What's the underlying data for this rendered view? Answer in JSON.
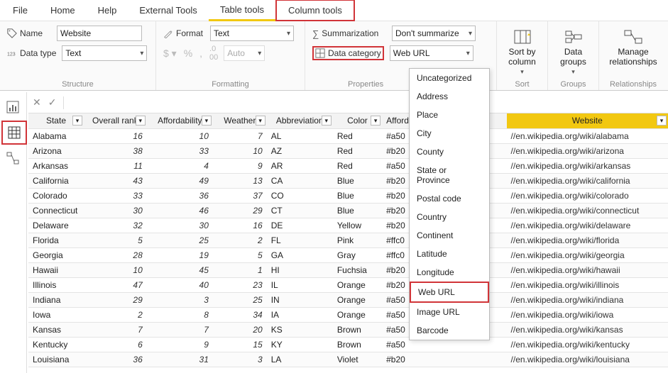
{
  "menu": {
    "items": [
      "File",
      "Home",
      "Help",
      "External Tools",
      "Table tools",
      "Column tools"
    ],
    "active_index": 4,
    "highlight_index": 5
  },
  "ribbon": {
    "structure": {
      "label": "Structure",
      "name_label": "Name",
      "name_value": "Website",
      "datatype_label": "Data type",
      "datatype_value": "Text"
    },
    "formatting": {
      "label": "Formatting",
      "format_label": "Format",
      "format_value": "Text",
      "auto_label": "Auto"
    },
    "properties": {
      "label": "Properties",
      "summarization_label": "Summarization",
      "summarization_value": "Don't summarize",
      "datacategory_label": "Data category",
      "datacategory_value": "Web URL"
    },
    "sort": {
      "label": "Sort",
      "btn": "Sort by\ncolumn"
    },
    "groups": {
      "label": "Groups",
      "btn": "Data\ngroups"
    },
    "relationships": {
      "label": "Relationships",
      "btn": "Manage\nrelationships"
    }
  },
  "data_category_options": [
    "Uncategorized",
    "Address",
    "Place",
    "City",
    "County",
    "State or Province",
    "Postal code",
    "Country",
    "Continent",
    "Latitude",
    "Longitude",
    "Web URL",
    "Image URL",
    "Barcode"
  ],
  "data_category_highlight": "Web URL",
  "table": {
    "columns": [
      "State",
      "Overall rank",
      "Affordability",
      "Weather",
      "Abbreviation",
      "Color",
      "Affordability color",
      "",
      "Website"
    ],
    "highlight_col": "Website",
    "rows": [
      {
        "state": "Alabama",
        "rank": 16,
        "aff": 10,
        "wea": 7,
        "abb": "AL",
        "color": "Red",
        "affc": "#a50",
        "url": "//en.wikipedia.org/wiki/alabama"
      },
      {
        "state": "Arizona",
        "rank": 38,
        "aff": 33,
        "wea": 10,
        "abb": "AZ",
        "color": "Red",
        "affc": "#b20",
        "url": "//en.wikipedia.org/wiki/arizona"
      },
      {
        "state": "Arkansas",
        "rank": 11,
        "aff": 4,
        "wea": 9,
        "abb": "AR",
        "color": "Red",
        "affc": "#a50",
        "url": "//en.wikipedia.org/wiki/arkansas"
      },
      {
        "state": "California",
        "rank": 43,
        "aff": 49,
        "wea": 13,
        "abb": "CA",
        "color": "Blue",
        "affc": "#b20",
        "url": "//en.wikipedia.org/wiki/california"
      },
      {
        "state": "Colorado",
        "rank": 33,
        "aff": 36,
        "wea": 37,
        "abb": "CO",
        "color": "Blue",
        "affc": "#b20",
        "url": "//en.wikipedia.org/wiki/colorado"
      },
      {
        "state": "Connecticut",
        "rank": 30,
        "aff": 46,
        "wea": 29,
        "abb": "CT",
        "color": "Blue",
        "affc": "#b20",
        "url": "//en.wikipedia.org/wiki/connecticut"
      },
      {
        "state": "Delaware",
        "rank": 32,
        "aff": 30,
        "wea": 16,
        "abb": "DE",
        "color": "Yellow",
        "affc": "#b20",
        "url": "//en.wikipedia.org/wiki/delaware"
      },
      {
        "state": "Florida",
        "rank": 5,
        "aff": 25,
        "wea": 2,
        "abb": "FL",
        "color": "Pink",
        "affc": "#ffc0",
        "url": "//en.wikipedia.org/wiki/florida"
      },
      {
        "state": "Georgia",
        "rank": 28,
        "aff": 19,
        "wea": 5,
        "abb": "GA",
        "color": "Gray",
        "affc": "#ffc0",
        "url": "//en.wikipedia.org/wiki/georgia"
      },
      {
        "state": "Hawaii",
        "rank": 10,
        "aff": 45,
        "wea": 1,
        "abb": "HI",
        "color": "Fuchsia",
        "affc": "#b20",
        "url": "//en.wikipedia.org/wiki/hawaii"
      },
      {
        "state": "Illinois",
        "rank": 47,
        "aff": 40,
        "wea": 23,
        "abb": "IL",
        "color": "Orange",
        "affc": "#b20",
        "url": "//en.wikipedia.org/wiki/illinois"
      },
      {
        "state": "Indiana",
        "rank": 29,
        "aff": 3,
        "wea": 25,
        "abb": "IN",
        "color": "Orange",
        "affc": "#a50",
        "url": "//en.wikipedia.org/wiki/indiana"
      },
      {
        "state": "Iowa",
        "rank": 2,
        "aff": 8,
        "wea": 34,
        "abb": "IA",
        "color": "Orange",
        "affc": "#a50",
        "url": "//en.wikipedia.org/wiki/iowa"
      },
      {
        "state": "Kansas",
        "rank": 7,
        "aff": 7,
        "wea": 20,
        "abb": "KS",
        "color": "Brown",
        "affc": "#a50",
        "url": "//en.wikipedia.org/wiki/kansas"
      },
      {
        "state": "Kentucky",
        "rank": 6,
        "aff": 9,
        "wea": 15,
        "abb": "KY",
        "color": "Brown",
        "affc": "#a50",
        "url": "//en.wikipedia.org/wiki/kentucky"
      },
      {
        "state": "Louisiana",
        "rank": 36,
        "aff": 31,
        "wea": 3,
        "abb": "LA",
        "color": "Violet",
        "affc": "#b20",
        "url": "//en.wikipedia.org/wiki/louisiana"
      }
    ]
  }
}
